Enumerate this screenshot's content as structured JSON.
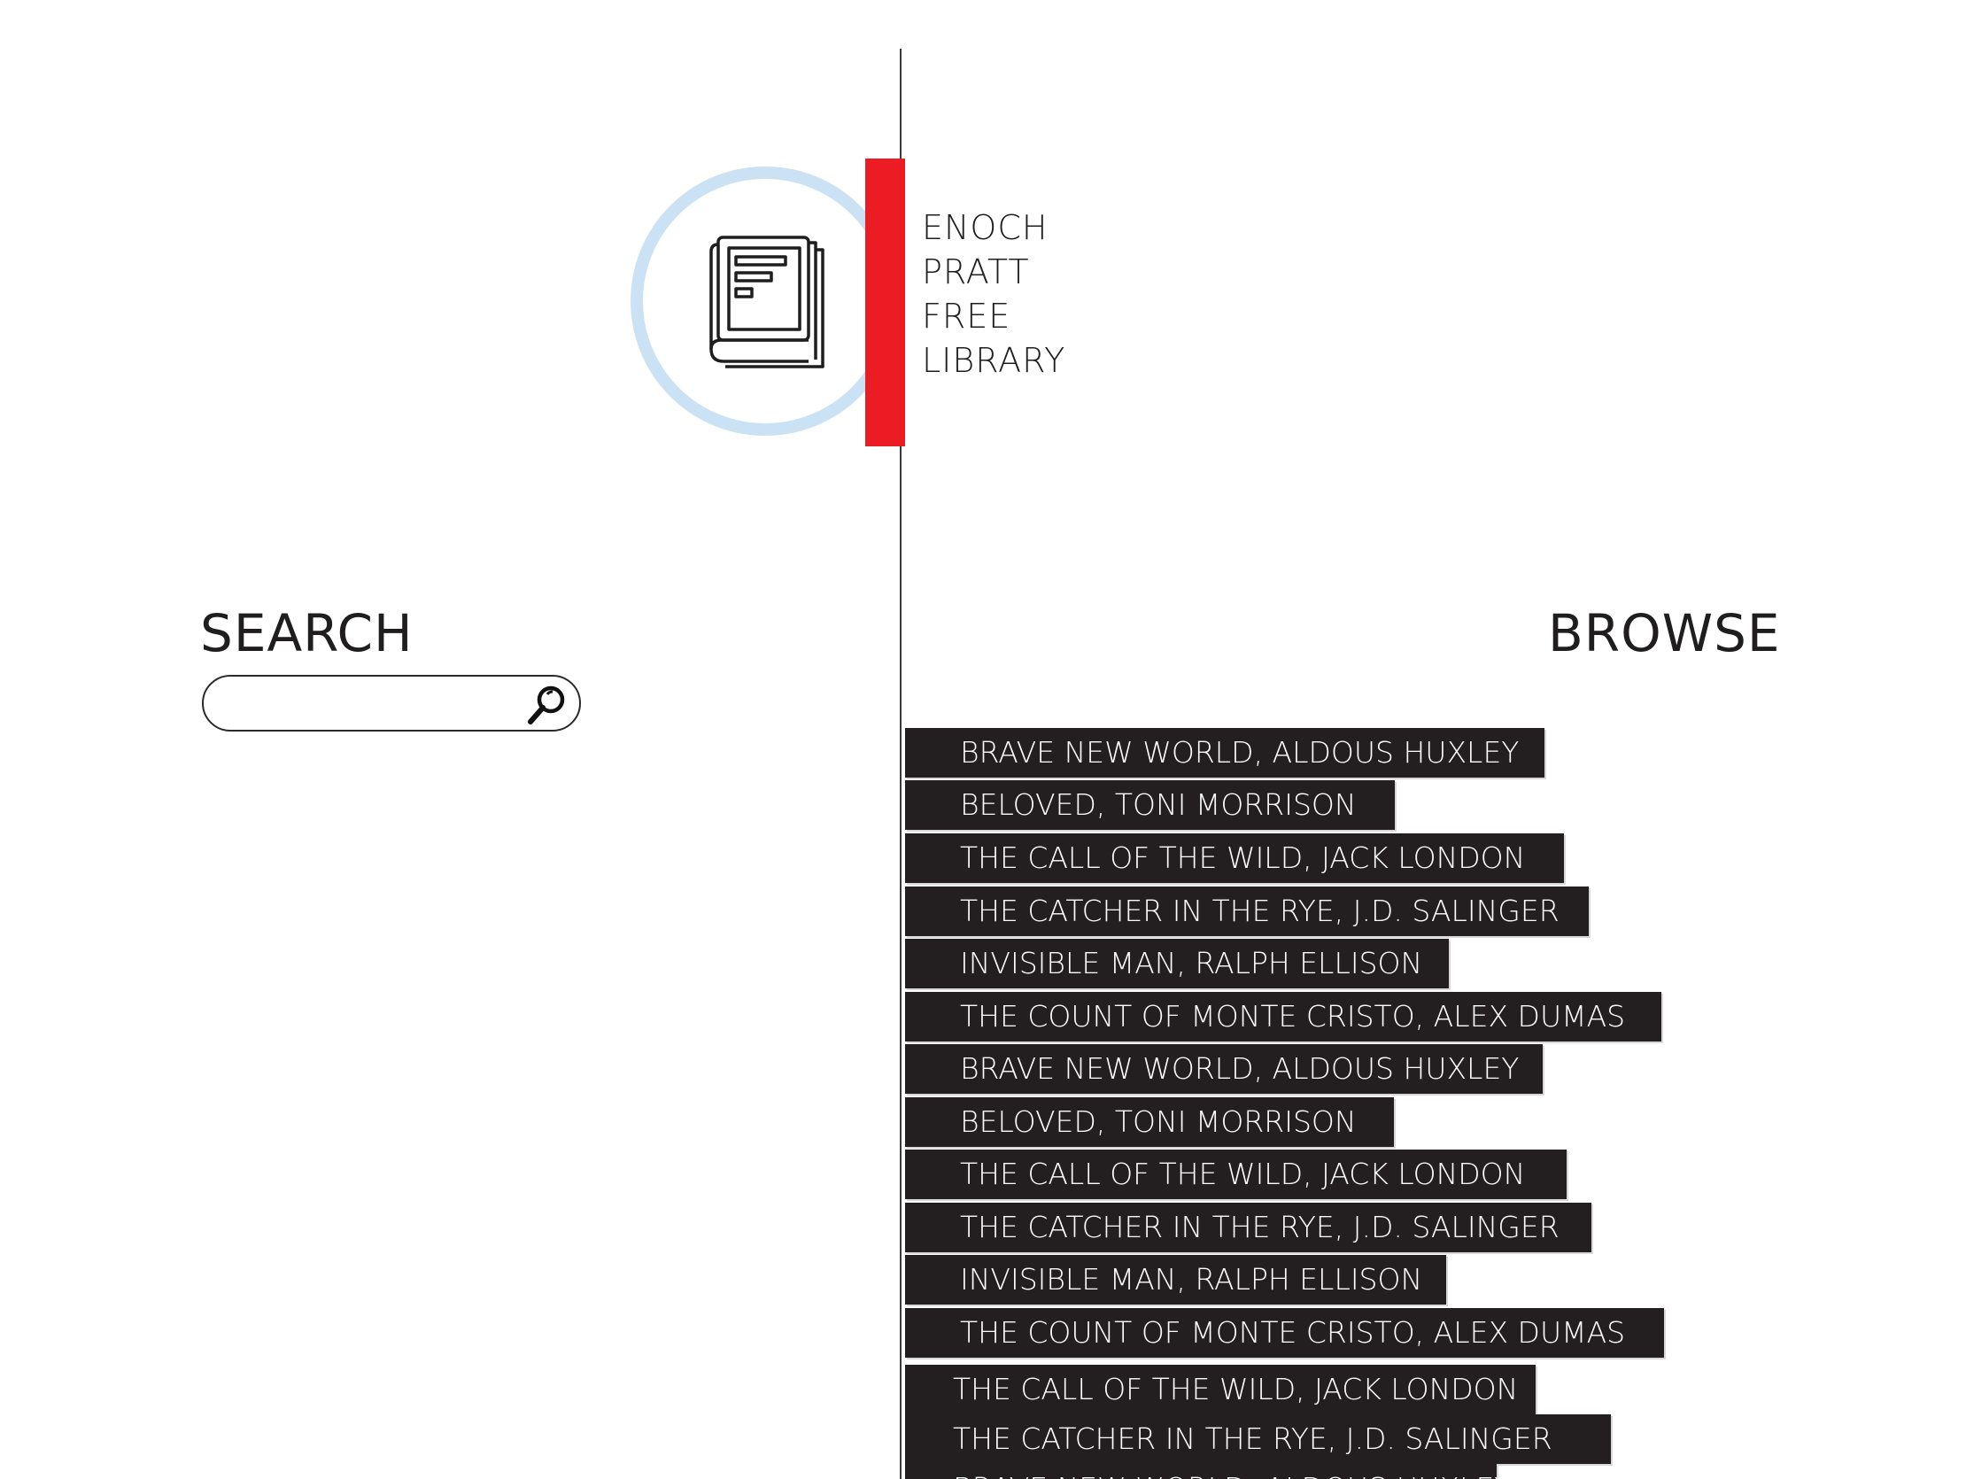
{
  "library": {
    "name_lines": [
      "ENOCH",
      "PRATT",
      "FREE",
      "LIBRARY"
    ]
  },
  "search": {
    "heading": "SEARCH",
    "value": "",
    "placeholder": "",
    "icon": "magnifier-icon"
  },
  "browse": {
    "heading": "BROWSE",
    "items": [
      "BRAVE NEW WORLD, ALDOUS HUXLEY",
      "BELOVED, TONI MORRISON",
      "THE CALL OF THE WILD, JACK LONDON",
      "THE CATCHER IN THE RYE, J.D. SALINGER",
      "INVISIBLE MAN,  RALPH ELLISON",
      "THE COUNT OF MONTE CRISTO, ALEX DUMAS",
      "BRAVE NEW WORLD, ALDOUS HUXLEY",
      "BELOVED, TONI MORRISON",
      "THE CALL OF THE WILD, JACK LONDON",
      "THE CATCHER IN THE RYE, J.D. SALINGER",
      "INVISIBLE MAN,  RALPH ELLISON",
      "THE COUNT OF MONTE CRISTO, ALEX DUMAS",
      "THE CALL OF THE WILD, JACK LONDON",
      "THE CATCHER IN THE RYE, J.D. SALINGER",
      "BRAVE NEW WORLD, ALDOUS HUXLEY"
    ]
  },
  "colors": {
    "accent_red": "#ec1c24",
    "ring_blue": "#cbe2f4",
    "item_bg": "#231f20",
    "text_dark": "#1f1d1e"
  }
}
